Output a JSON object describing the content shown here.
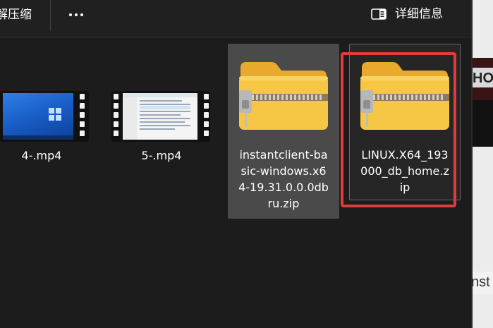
{
  "toolbar": {
    "extract_label": "解压缩",
    "more_icon": "more-horizontal-icon",
    "details_icon": "details-pane-icon",
    "details_label": "详细信息"
  },
  "files": [
    {
      "name": "4-.mp4",
      "kind": "video",
      "icon": "video-file-icon"
    },
    {
      "name": "5-.mp4",
      "kind": "video",
      "icon": "video-file-icon"
    },
    {
      "name_lines": [
        "instantclient-ba",
        "sic-windows.x6",
        "4-19.31.0.0.0db",
        "ru.zip"
      ],
      "kind": "zip",
      "icon": "zip-folder-icon",
      "state": "selected"
    },
    {
      "name_lines": [
        "LINUX.X64_193",
        "000_db_home.z",
        "ip"
      ],
      "kind": "zip",
      "icon": "zip-folder-icon",
      "state": "highlighted"
    }
  ],
  "colors": {
    "background": "#1c1c1c",
    "toolbar": "#202020",
    "selected_bg": "#4a4a4a",
    "highlight_border": "#e23b3b",
    "folder": "#f5c542"
  }
}
